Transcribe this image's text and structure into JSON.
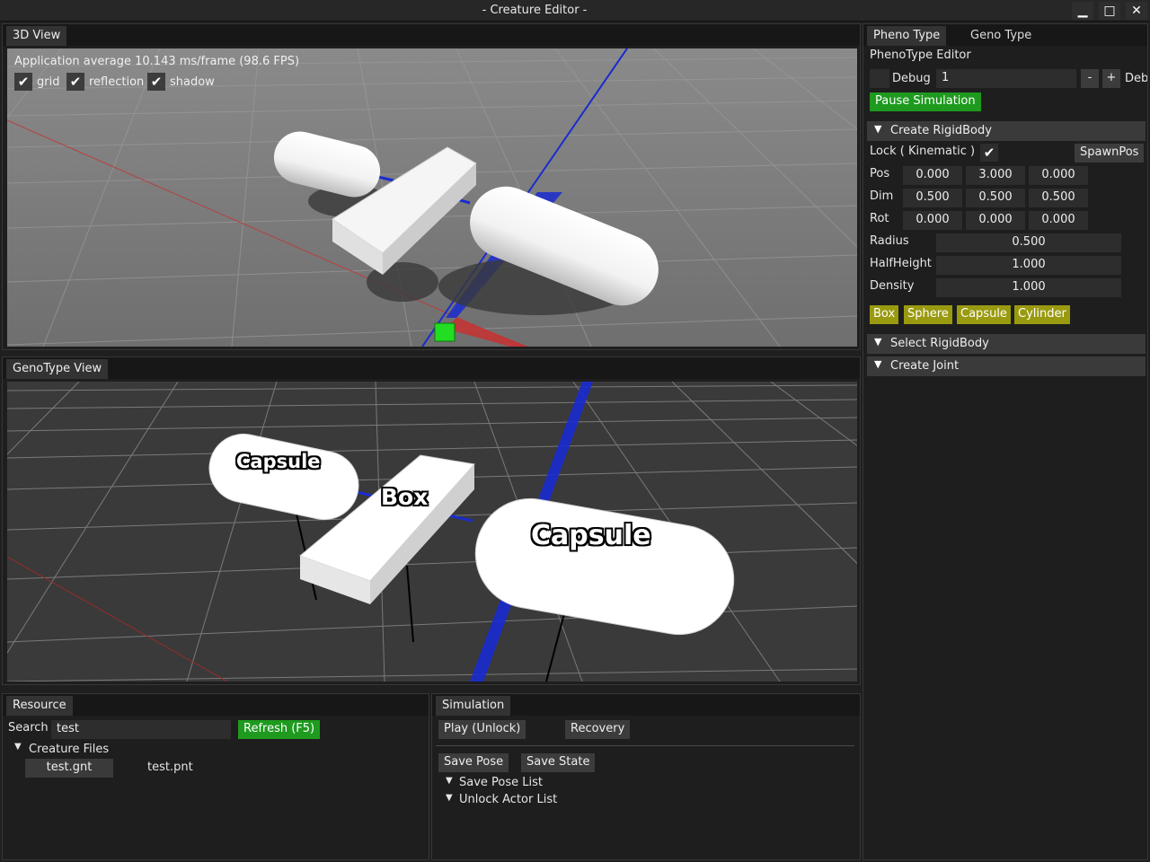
{
  "window": {
    "title": "- Creature Editor -",
    "minimize_glyph": "▁",
    "maximize_glyph": "□",
    "close_glyph": "✕"
  },
  "view3d": {
    "tab": "3D View",
    "fps_text": "Application average 10.143 ms/frame (98.6 FPS)",
    "checkboxes": [
      {
        "label": "grid",
        "checked": true
      },
      {
        "label": "reflection",
        "checked": true
      },
      {
        "label": "shadow",
        "checked": true
      }
    ],
    "check_glyph": "✔"
  },
  "genoview": {
    "tab": "GenoType View",
    "labels": [
      "Capsule",
      "Box",
      "Capsule"
    ]
  },
  "resource": {
    "tab": "Resource",
    "search_label": "Search",
    "search_value": "test",
    "refresh_label": "Refresh (F5)",
    "tree_label": "Creature Files",
    "files": [
      "test.gnt",
      "test.pnt"
    ]
  },
  "simulation": {
    "tab": "Simulation",
    "play_label": "Play (Unlock)",
    "recovery_label": "Recovery",
    "save_pose_label": "Save Pose",
    "save_state_label": "Save State",
    "save_pose_list": "Save Pose List",
    "unlock_actor_list": "Unlock Actor List"
  },
  "right": {
    "tabs": [
      "Pheno Type",
      "Geno Type"
    ],
    "editor_title": "PhenoType Editor",
    "debug_label": "Debug",
    "debug_value": "1",
    "minus": "-",
    "plus": "+",
    "debug_trail": "Deb",
    "pause_label": "Pause Simulation",
    "create_rigidbody": "Create RigidBody",
    "lock_label": "Lock ( Kinematic )",
    "lock_checked": true,
    "spawnpos_label": "SpawnPos",
    "pos_label": "Pos",
    "pos": [
      "0.000",
      "3.000",
      "0.000"
    ],
    "dim_label": "Dim",
    "dim": [
      "0.500",
      "0.500",
      "0.500"
    ],
    "rot_label": "Rot",
    "rot": [
      "0.000",
      "0.000",
      "0.000"
    ],
    "radius_label": "Radius",
    "radius": "0.500",
    "halfheight_label": "HalfHeight",
    "halfheight": "1.000",
    "density_label": "Density",
    "density": "1.000",
    "shape_buttons": [
      "Box",
      "Sphere",
      "Capsule",
      "Cylinder"
    ],
    "select_rigidbody": "Select RigidBody",
    "create_joint": "Create Joint"
  },
  "colors": {
    "accent_green": "#1e9a1e",
    "olive": "#9a9a10",
    "panel_bg": "#1e1e1e",
    "axis_blue": "#1a2bd0",
    "axis_red": "#c83030",
    "gizmo_green": "#22dd22"
  }
}
